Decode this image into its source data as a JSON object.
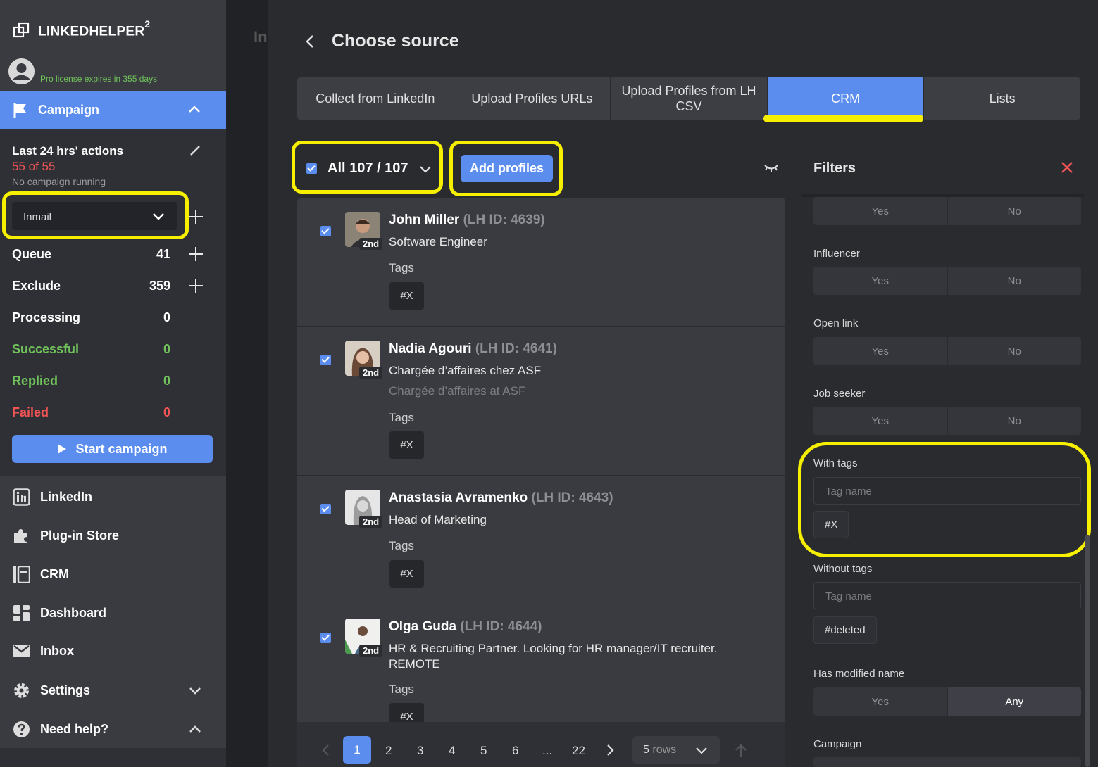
{
  "app": {
    "logo_text": "LINKEDHELPER",
    "logo_sup": "2",
    "license": "Pro license expires in 355 days"
  },
  "campaign": {
    "header": "Campaign",
    "last24": "Last 24 hrs' actions",
    "count": "55 of 55",
    "status": "No campaign running",
    "selected": "Inmail",
    "stats": [
      {
        "label": "Queue",
        "value": "41",
        "color": "#ffffff"
      },
      {
        "label": "Exclude",
        "value": "359",
        "color": "#ffffff"
      },
      {
        "label": "Processing",
        "value": "0",
        "color": "#ffffff"
      },
      {
        "label": "Successful",
        "value": "0",
        "color": "#6fc35a"
      },
      {
        "label": "Replied",
        "value": "0",
        "color": "#6fc35a"
      },
      {
        "label": "Failed",
        "value": "0",
        "color": "#f05454"
      }
    ],
    "start_label": "Start campaign"
  },
  "nav": [
    {
      "label": "LinkedIn",
      "icon": "linkedin-icon"
    },
    {
      "label": "Plug-in Store",
      "icon": "puzzle-icon"
    },
    {
      "label": "CRM",
      "icon": "crm-icon"
    },
    {
      "label": "Dashboard",
      "icon": "dashboard-icon"
    },
    {
      "label": "Inbox",
      "icon": "mail-icon"
    },
    {
      "label": "Settings",
      "icon": "gear-icon"
    },
    {
      "label": "Need help?",
      "icon": "help-icon"
    }
  ],
  "background": {
    "title_fragment": "In"
  },
  "modal": {
    "title": "Choose source",
    "tabs": [
      "Collect from LinkedIn",
      "Upload Profiles URLs",
      "Upload Profiles from LH CSV",
      "CRM",
      "Lists"
    ],
    "active_tab": "CRM",
    "select_all": "All 107 / 107",
    "add_button": "Add profiles"
  },
  "profiles": [
    {
      "name": "John Miller",
      "lhid": "(LH ID: 4639)",
      "degree": "2nd",
      "headline": "Software Engineer",
      "sub": "",
      "tags_label": "Tags",
      "tags": [
        "#X"
      ]
    },
    {
      "name": "Nadia Agouri",
      "lhid": "(LH ID: 4641)",
      "degree": "2nd",
      "headline": "Chargée d’affaires chez ASF",
      "sub": "Chargée d’affaires at ASF",
      "tags_label": "Tags",
      "tags": [
        "#X"
      ]
    },
    {
      "name": "Anastasia Avramenko",
      "lhid": "(LH ID: 4643)",
      "degree": "2nd",
      "headline": "Head of Marketing",
      "sub": "",
      "tags_label": "Tags",
      "tags": [
        "#X"
      ]
    },
    {
      "name": "Olga Guda",
      "lhid": "(LH ID: 4644)",
      "degree": "2nd",
      "headline": "HR & Recruiting Partner. Looking for HR manager/IT recruiter. REMOTE",
      "sub": "",
      "tags_label": "Tags",
      "tags": [
        "#X"
      ]
    }
  ],
  "pagination": {
    "pages": [
      "1",
      "2",
      "3",
      "4",
      "5",
      "6",
      "...",
      "22"
    ],
    "current": "1",
    "rows_value": "5",
    "rows_label": "rows"
  },
  "filters": {
    "title": "Filters",
    "first_segment": {
      "yes": "Yes",
      "no": "No"
    },
    "influencer": {
      "label": "Influencer",
      "yes": "Yes",
      "no": "No"
    },
    "open_link": {
      "label": "Open link",
      "yes": "Yes",
      "no": "No"
    },
    "job_seeker": {
      "label": "Job seeker",
      "yes": "Yes",
      "no": "No"
    },
    "with_tags": {
      "label": "With tags",
      "placeholder": "Tag name",
      "tags": [
        "#X"
      ]
    },
    "without_tags": {
      "label": "Without tags",
      "placeholder": "Tag name",
      "tags": [
        "#deleted"
      ]
    },
    "modified_name": {
      "label": "Has modified name",
      "yes": "Yes",
      "any": "Any"
    },
    "campaign": {
      "label": "Campaign"
    }
  },
  "colors": {
    "accent": "#5b8def",
    "highlight": "#f6f000",
    "success": "#6fc35a",
    "danger": "#f05454"
  }
}
